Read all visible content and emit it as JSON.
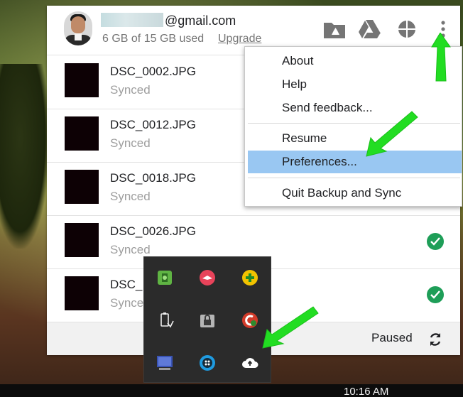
{
  "account": {
    "email_domain": "@gmail.com",
    "storage_text": "6 GB of 15 GB used",
    "upgrade_label": "Upgrade"
  },
  "header_icons": [
    "folder-drive-icon",
    "google-drive-icon",
    "google-photos-icon",
    "more-vert-icon"
  ],
  "files": [
    {
      "name": "DSC_0002.JPG",
      "status": "Synced",
      "checked": false
    },
    {
      "name": "DSC_0012.JPG",
      "status": "Synced",
      "checked": false
    },
    {
      "name": "DSC_0018.JPG",
      "status": "Synced",
      "checked": false
    },
    {
      "name": "DSC_0026.JPG",
      "status": "Synced",
      "checked": true
    },
    {
      "name": "DSC_",
      "status": "Synce",
      "checked": true
    }
  ],
  "footer": {
    "status": "Paused"
  },
  "menu": {
    "items": [
      "About",
      "Help",
      "Send feedback...",
      "Resume",
      "Preferences...",
      "Quit Backup and Sync"
    ],
    "highlighted": "Preferences..."
  },
  "tray": {
    "icons": [
      "evernote-icon",
      "skitch-icon",
      "add-plus-icon",
      "usb-drive-icon",
      "lock-icon",
      "ccleaner-icon",
      "display-icon",
      "dotted-circle-icon",
      "backup-sync-cloud-icon"
    ]
  },
  "clock": {
    "time": "10:16 AM"
  },
  "colors": {
    "accent_green": "#1e9e58",
    "menu_highlight": "#99c7f2",
    "annotation_arrow": "#22dd22"
  }
}
